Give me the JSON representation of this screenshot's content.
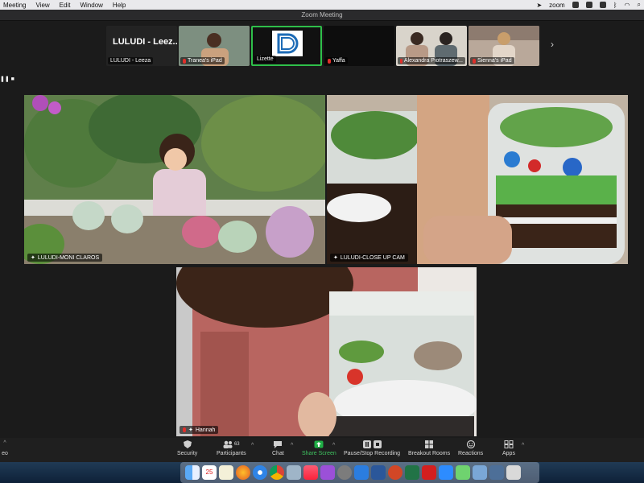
{
  "menubar": {
    "app": "Meeting",
    "items": [
      "View",
      "Edit",
      "Window",
      "Help"
    ],
    "right_app": "zoom"
  },
  "window_title": "Zoom Meeting",
  "filmstrip": [
    {
      "display_name": "LULUDI - Leez...",
      "label": "LULUDI - Leeza",
      "muted": false,
      "type": "name"
    },
    {
      "label": "Tranea's iPad",
      "muted": true,
      "type": "video"
    },
    {
      "label": "Lizette",
      "muted": false,
      "type": "logo",
      "active": true
    },
    {
      "label": "Yaffa",
      "muted": true,
      "type": "dark"
    },
    {
      "label": "Alexandra Piotraszew...",
      "muted": true,
      "type": "video"
    },
    {
      "label": "Sienna's iPad",
      "muted": true,
      "type": "video"
    }
  ],
  "tiles": [
    {
      "label": "LULUDI-MONI CLAROS"
    },
    {
      "label": "LULUDI-CLOSE UP CAM"
    },
    {
      "label": "Hannah"
    }
  ],
  "toolbar": {
    "security": "Security",
    "participants": "Participants",
    "participants_count": "63",
    "chat": "Chat",
    "share": "Share Screen",
    "record": "Pause/Stop Recording",
    "breakout": "Breakout Rooms",
    "reactions": "Reactions",
    "apps": "Apps",
    "video_partial": "eo"
  },
  "dock": {
    "calendar_day": "25"
  },
  "colors": {
    "accent_green": "#2fbf4a",
    "mute_red": "#e0302b"
  }
}
